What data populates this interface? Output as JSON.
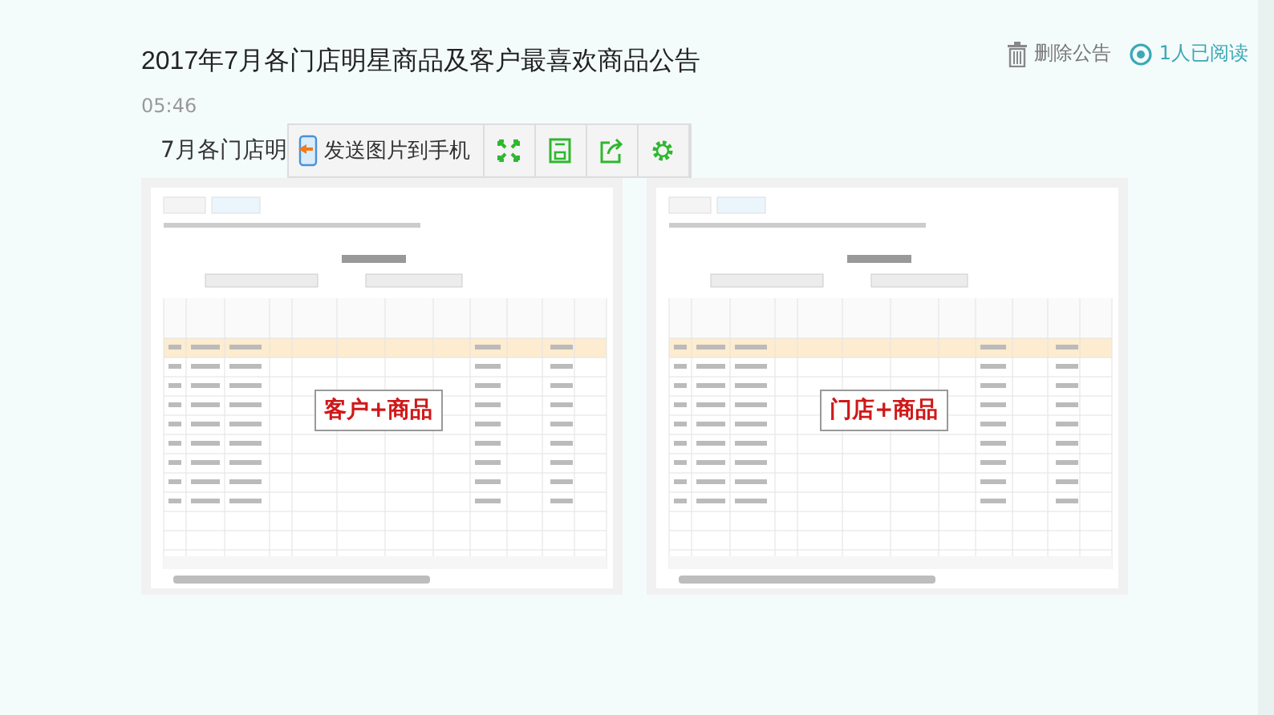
{
  "header": {
    "title": "2017年7月各门店明星商品及客户最喜欢商品公告",
    "actions": [
      {
        "kind": "delete",
        "label": "删除公告"
      },
      {
        "kind": "readers",
        "label": "1人已阅读"
      }
    ]
  },
  "time": "05:46",
  "body_text": "7月各门店明",
  "image_toolbar": {
    "send_label": "发送图片到手机",
    "tools": [
      {
        "kind": "fullscreen"
      },
      {
        "kind": "save"
      },
      {
        "kind": "share"
      },
      {
        "kind": "settings"
      }
    ]
  },
  "images": [
    {
      "caption": "客户+商品",
      "first_row_highlighted": true
    },
    {
      "caption": "门店+商品",
      "first_row_highlighted": true
    }
  ]
}
